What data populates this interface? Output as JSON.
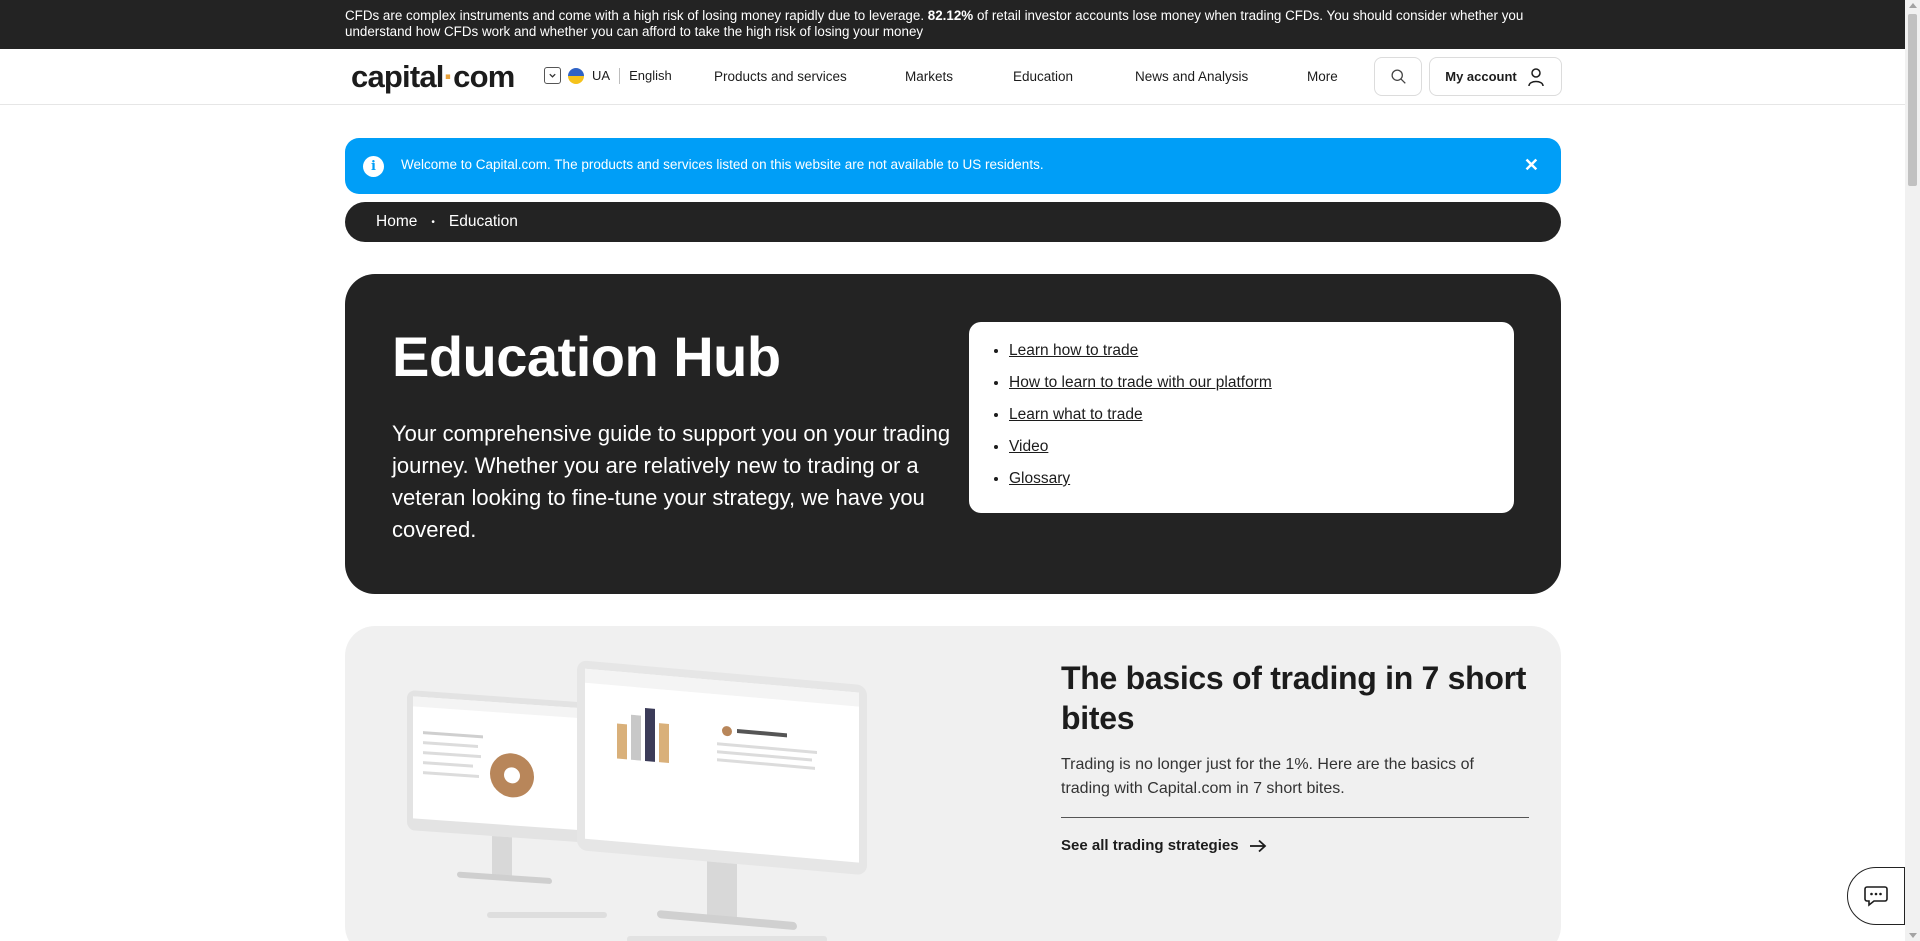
{
  "risk_warning": {
    "text_before": "CFDs are complex instruments and come with a high risk of losing money rapidly due to leverage.",
    "percent": "82.12%",
    "text_after": "of retail investor accounts lose money when trading CFDs. You should consider whether you understand how CFDs work and whether you can afford to take the high risk of losing your money"
  },
  "header": {
    "logo_left": "capital",
    "logo_dot": "·",
    "logo_right": "com",
    "region": "UA",
    "language": "English",
    "nav": [
      "Products and services",
      "Markets",
      "Education",
      "News and Analysis",
      "More"
    ],
    "account_label": "My account"
  },
  "notice": {
    "info_glyph": "i",
    "message": "Welcome to Capital.com. The products and services listed on this website are not available to US residents.",
    "close_glyph": "✕"
  },
  "breadcrumb": {
    "items": [
      "Home",
      "Education"
    ],
    "separator": "•"
  },
  "hero": {
    "title": "Education Hub",
    "description": "Your comprehensive guide to support you on your trading journey. Whether you are relatively new to trading or a veteran looking to fine-tune your strategy, we have you covered.",
    "links": [
      "Learn how to trade",
      "How to learn to trade with our platform",
      "Learn what to trade",
      "Video",
      "Glossary"
    ]
  },
  "basics": {
    "title": "The basics of trading in 7 short bites",
    "description": "Trading is no longer just for the 1%. Here are the basics of trading with Capital.com in 7 short bites.",
    "cta": "See all trading strategies"
  },
  "colors": {
    "dark": "#232323",
    "notice_blue": "#009ef7",
    "logo_accent": "#e9a23b",
    "card_grey": "#f0f0f0"
  },
  "icons": [
    "chevron-down-icon",
    "ua-flag-icon",
    "search-icon",
    "user-icon",
    "info-icon",
    "close-icon",
    "arrow-right-icon",
    "chat-icon"
  ]
}
